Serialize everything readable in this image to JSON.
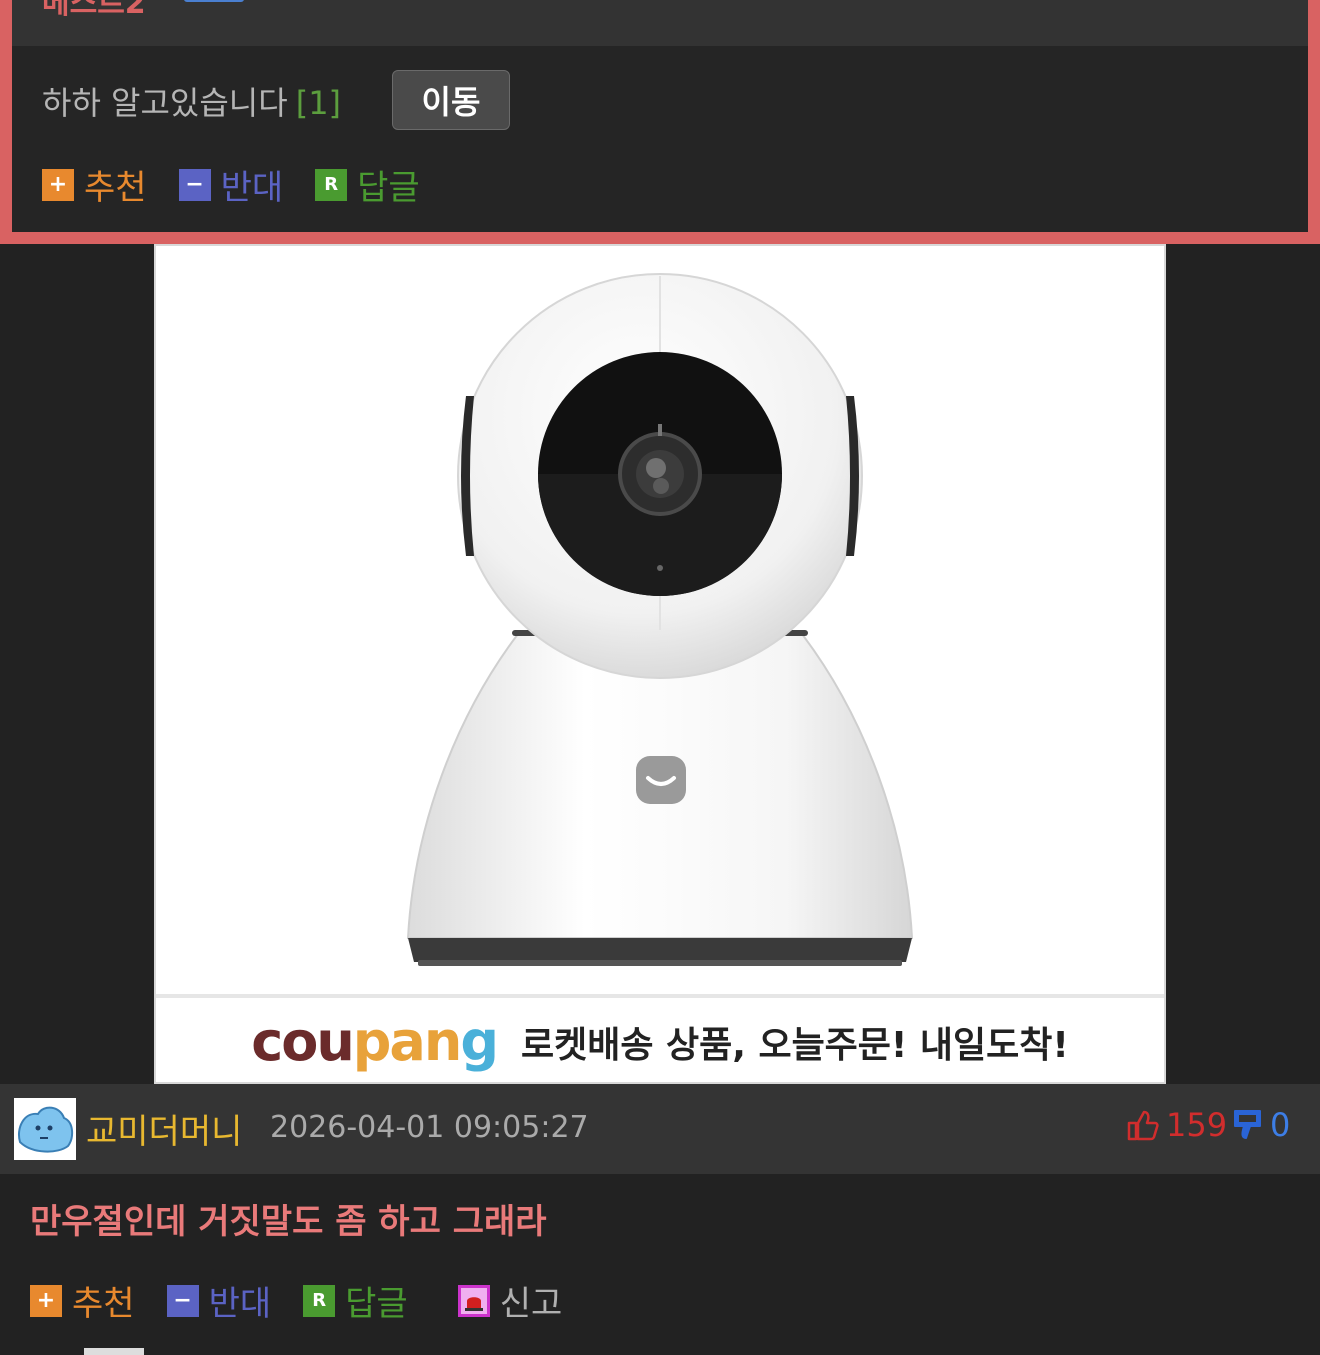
{
  "best_comment": {
    "text": "하하 알고있습니다",
    "reply_count": "[1]",
    "move_button": "이동",
    "actions": {
      "recommend": "추천",
      "oppose": "반대",
      "reply": "답글"
    }
  },
  "ad": {
    "brand": {
      "part1": "cou",
      "part2": "pan",
      "part3": "g"
    },
    "tagline": "로켓배송 상품, 오늘주문! 내일도착!"
  },
  "comment": {
    "nickname": "교미더머니",
    "datetime": "2026-04-01 09:05:27",
    "likes": "159",
    "dislikes": "0",
    "text": "만우절인데 거짓말도 좀 하고 그래라",
    "actions": {
      "recommend": "추천",
      "oppose": "반대",
      "reply": "답글",
      "report": "신고"
    }
  },
  "colors": {
    "best_border": "#d96262",
    "recommend": "#e8892e",
    "oppose": "#5b63c4",
    "reply": "#4a9b30",
    "nickname": "#e8b830",
    "comment_text": "#e97a7a"
  }
}
